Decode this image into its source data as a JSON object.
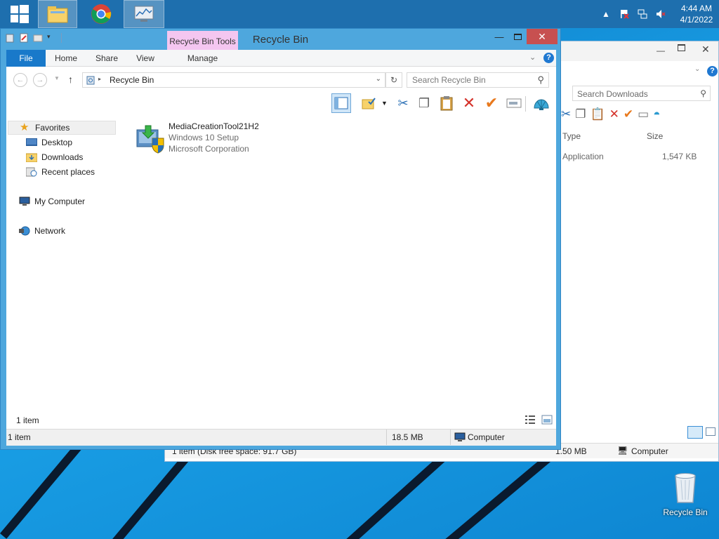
{
  "taskbar": {
    "buttons": [
      {
        "name": "start-icon"
      },
      {
        "name": "file-explorer-icon"
      },
      {
        "name": "chrome-icon"
      },
      {
        "name": "system-monitor-icon"
      }
    ],
    "clock": {
      "time": "4:44 AM",
      "date": "4/1/2022"
    }
  },
  "window": {
    "title": "Recycle Bin",
    "context_tab": "Recycle Bin Tools",
    "ribbon_tabs": [
      "File",
      "Home",
      "Share",
      "View",
      "Manage"
    ],
    "address": "Recycle Bin",
    "search_placeholder": "Search Recycle Bin",
    "nav": {
      "favorites": "Favorites",
      "desktop": "Desktop",
      "downloads": "Downloads",
      "recent": "Recent places",
      "computer": "My Computer",
      "network": "Network"
    },
    "file": {
      "name": "MediaCreationTool21H2",
      "description": "Windows 10 Setup",
      "company": "Microsoft Corporation"
    },
    "status_count": "1 item",
    "status_bar": {
      "items": "1 item",
      "size": "18.5 MB",
      "location": "Computer"
    }
  },
  "background_window": {
    "search_placeholder": "Search Downloads",
    "columns": [
      "Type",
      "Size"
    ],
    "row": {
      "type": "Application",
      "size": "1,547 KB"
    },
    "status": "1 item (Disk free space: 91.7 GB)",
    "status_size": "1.50 MB",
    "status_location": "Computer"
  },
  "desktop_icon": {
    "label": "Recycle Bin"
  },
  "colors": {
    "accent": "#1979ca",
    "context_tab": "#f4c6f0",
    "window_frame": "#4ea7dd"
  }
}
